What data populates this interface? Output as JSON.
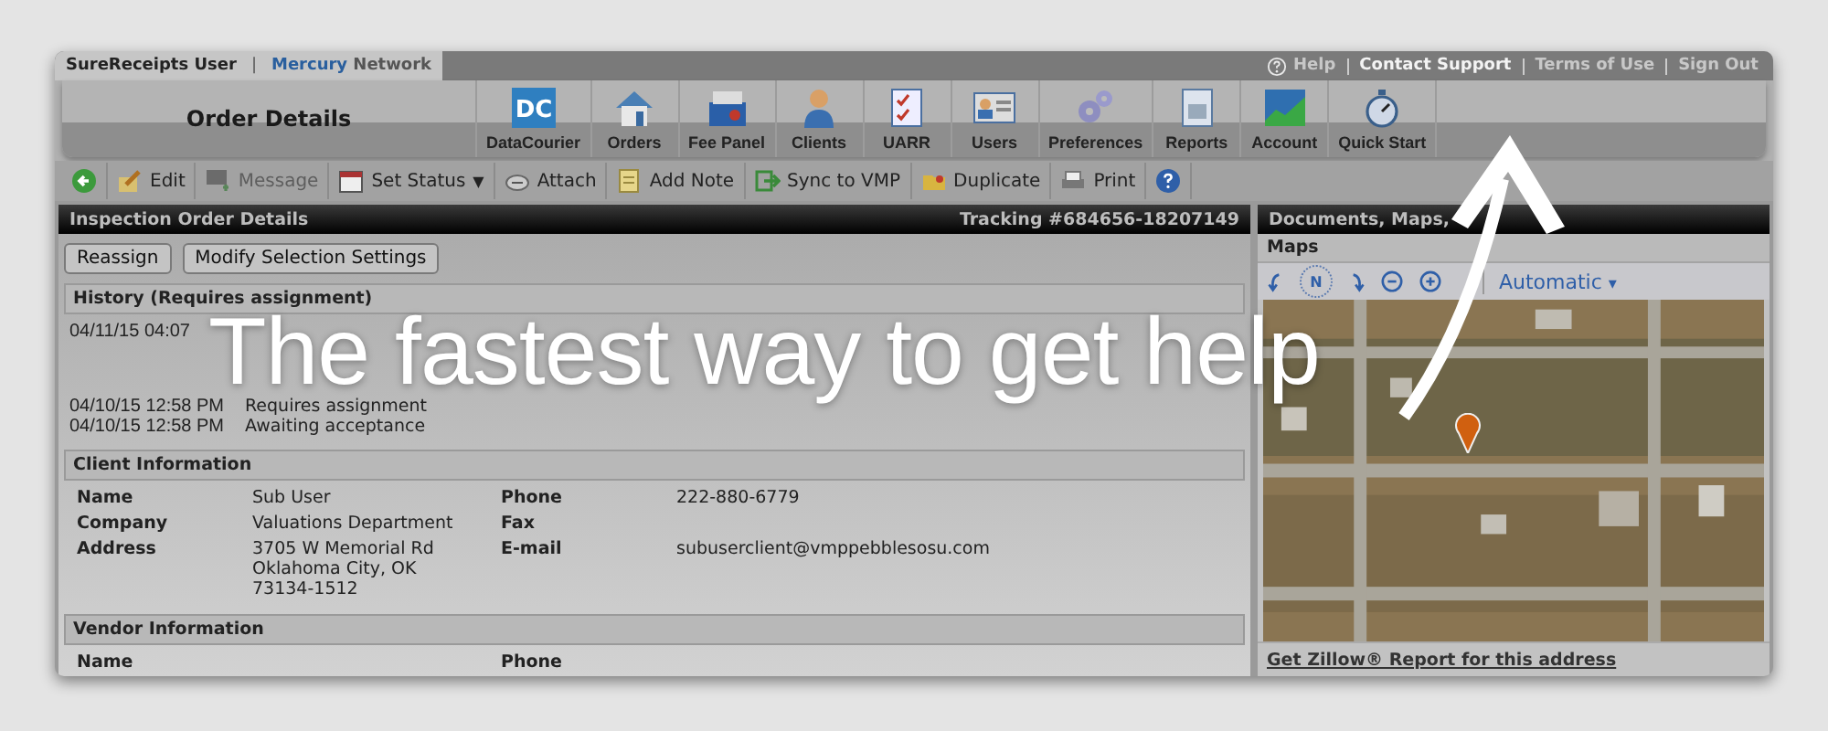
{
  "header": {
    "user": "SureReceipts User",
    "separator": "|",
    "brand_bold": "Mercury",
    "brand_rest": "Network",
    "links": [
      {
        "label": "Help",
        "highlighted": false,
        "help_icon": true
      },
      {
        "label": "Contact Support",
        "highlighted": true
      },
      {
        "label": "Terms of Use",
        "highlighted": false
      },
      {
        "label": "Sign Out",
        "highlighted": false
      }
    ]
  },
  "page_title": "Order Details",
  "nav": [
    {
      "label": "DataCourier",
      "kind": "dc",
      "icon_text": "DC"
    },
    {
      "label": "Orders",
      "kind": "house"
    },
    {
      "label": "Fee Panel",
      "kind": "box"
    },
    {
      "label": "Clients",
      "kind": "person"
    },
    {
      "label": "UARR",
      "kind": "checklist"
    },
    {
      "label": "Users",
      "kind": "idcard"
    },
    {
      "label": "Preferences",
      "kind": "gears"
    },
    {
      "label": "Reports",
      "kind": "document"
    },
    {
      "label": "Account",
      "kind": "chart"
    },
    {
      "label": "Quick Start",
      "kind": "stopwatch"
    }
  ],
  "toolbar": [
    {
      "kind": "back",
      "disabled": false
    },
    {
      "kind": "edit",
      "label": "Edit",
      "disabled": false
    },
    {
      "kind": "message",
      "label": "Message",
      "disabled": true
    },
    {
      "kind": "calendar",
      "label": "Set Status",
      "caret": "▼",
      "disabled": false
    },
    {
      "kind": "attach",
      "label": "Attach",
      "disabled": false
    },
    {
      "kind": "note",
      "label": "Add Note",
      "disabled": false
    },
    {
      "kind": "sync",
      "label": "Sync to VMP",
      "disabled": false
    },
    {
      "kind": "folder",
      "label": "Duplicate",
      "disabled": false
    },
    {
      "kind": "print",
      "label": "Print",
      "disabled": false
    },
    {
      "kind": "help",
      "disabled": false
    }
  ],
  "order_panel": {
    "title": "Inspection Order Details",
    "tracking": "Tracking #684656-18207149",
    "buttons": [
      "Reassign",
      "Modify Selection Settings"
    ],
    "history": {
      "title": "History (Requires assignment)",
      "entries": [
        {
          "date": "04/11/15 04:07"
        },
        {
          "date": "04/10/15 12:58 PM",
          "text": "Requires assignment"
        },
        {
          "date": "04/10/15 12:58 PM",
          "text": "Awaiting acceptance"
        }
      ]
    },
    "client": {
      "title": "Client Information",
      "rows": [
        {
          "label": "Name",
          "value": "Sub User",
          "label2": "Phone",
          "value2": "222-880-6779"
        },
        {
          "label": "Company",
          "value": "Valuations Department",
          "label2": "Fax"
        },
        {
          "label": "Address",
          "value": "3705 W Memorial Rd Oklahoma City, OK 73134-1512",
          "label2": "E-mail",
          "value2": "subuserclient@vmppebblesosu.com"
        }
      ]
    },
    "vendor": {
      "title": "Vendor Information",
      "rows": [
        {
          "label": "Name",
          "label2": "Phone"
        }
      ]
    }
  },
  "docs_panel": {
    "title": "Documents, Maps,",
    "maps_title": "Maps",
    "compass": "N",
    "map_mode": "Automatic",
    "map_mode_caret": "▾",
    "zillow_link": "Get Zillow® Report for this address"
  },
  "overlay": {
    "headline": "The fastest way to get help"
  }
}
